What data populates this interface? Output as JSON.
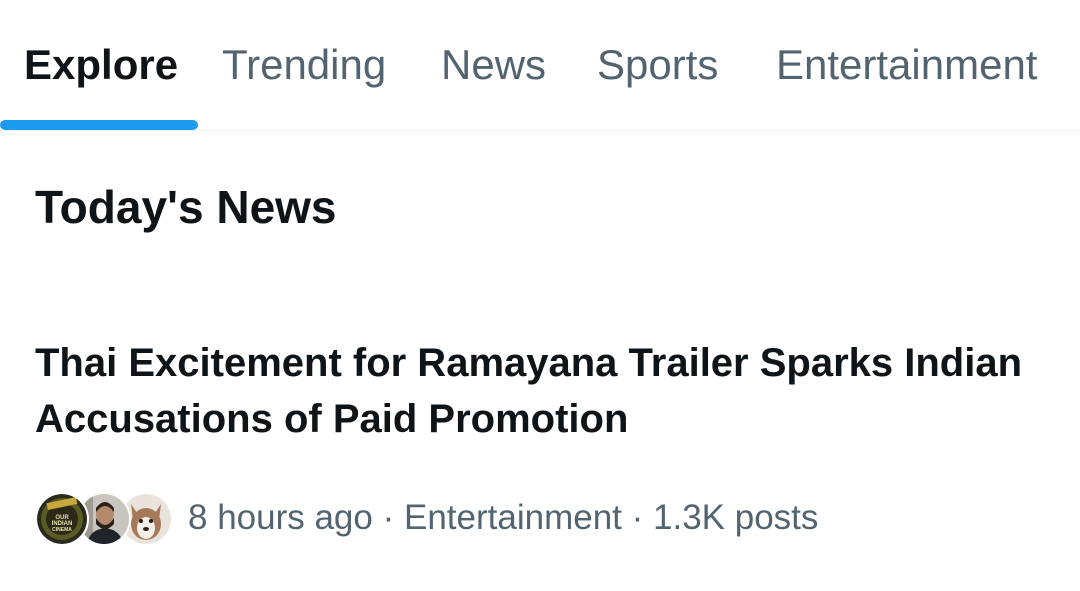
{
  "tabs": [
    {
      "label": "Explore",
      "active": true
    },
    {
      "label": "Trending",
      "active": false
    },
    {
      "label": "News",
      "active": false
    },
    {
      "label": "Sports",
      "active": false
    },
    {
      "label": "Entertainment",
      "active": false
    }
  ],
  "accent_color": "#1d9bf0",
  "section": {
    "title": "Today's News"
  },
  "news": {
    "headline": "Thai Excitement for Ramayana Trailer Sparks Indian Accusations of Paid Promotion",
    "time": "8 hours ago",
    "separator": "·",
    "category": "Entertainment",
    "posts": "1.3K posts",
    "avatars": [
      {
        "name": "our-indian-cinema-logo",
        "text": "OUR INDIAN CINEMA"
      },
      {
        "name": "bearded-man-avatar"
      },
      {
        "name": "husky-dog-avatar"
      }
    ]
  }
}
